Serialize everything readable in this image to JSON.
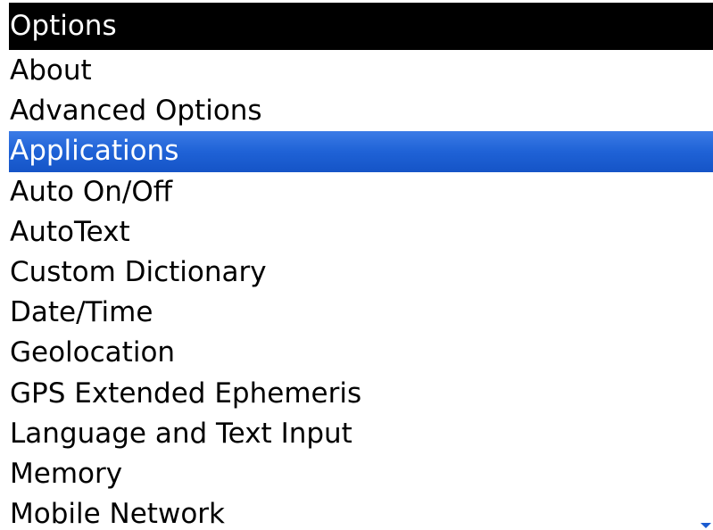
{
  "header": {
    "title": "Options"
  },
  "menu": {
    "selected_index": 2,
    "items": [
      {
        "label": "About"
      },
      {
        "label": "Advanced Options"
      },
      {
        "label": "Applications"
      },
      {
        "label": "Auto On/Off"
      },
      {
        "label": "AutoText"
      },
      {
        "label": "Custom Dictionary"
      },
      {
        "label": "Date/Time"
      },
      {
        "label": "Geolocation"
      },
      {
        "label": "GPS Extended Ephemeris"
      },
      {
        "label": "Language and Text Input"
      },
      {
        "label": "Memory"
      },
      {
        "label": "Mobile Network"
      }
    ]
  },
  "colors": {
    "title_bar": "#000000",
    "selection": "#1f62d6",
    "scroll_indicator": "#1a5bd0"
  },
  "icons": {
    "scroll_indicator": "scroll-down-arrow-icon"
  }
}
